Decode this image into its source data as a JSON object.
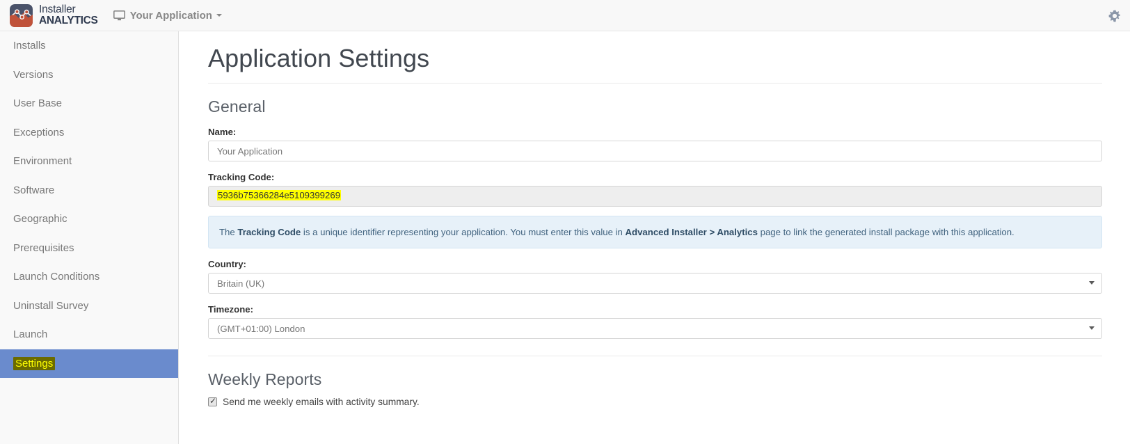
{
  "topbar": {
    "brand_line1": "Installer",
    "brand_line2": "ANALYTICS",
    "app_switcher_label": "Your Application",
    "settings_icon": "gear-icon",
    "monitor_icon": "monitor-icon",
    "logo_top_color": "#4a5269",
    "logo_bottom_color": "#c0523a"
  },
  "sidebar": {
    "items": [
      {
        "label": "Installs",
        "active": false
      },
      {
        "label": "Versions",
        "active": false
      },
      {
        "label": "User Base",
        "active": false
      },
      {
        "label": "Exceptions",
        "active": false
      },
      {
        "label": "Environment",
        "active": false
      },
      {
        "label": "Software",
        "active": false
      },
      {
        "label": "Geographic",
        "active": false
      },
      {
        "label": "Prerequisites",
        "active": false
      },
      {
        "label": "Launch Conditions",
        "active": false
      },
      {
        "label": "Uninstall Survey",
        "active": false
      },
      {
        "label": "Launch",
        "active": false
      },
      {
        "label": "Settings",
        "active": true
      }
    ],
    "active_bg": "#6a8bcd",
    "highlight_bg": "#6b6b00",
    "highlight_fg": "#ffff00"
  },
  "main": {
    "page_title": "Application Settings",
    "general": {
      "section_title": "General",
      "name_label": "Name:",
      "name_value": "Your Application",
      "tracking_label": "Tracking Code:",
      "tracking_value": "5936b75366284e5109399269",
      "tracking_highlight_color": "#ffff00",
      "alert": {
        "part1": "The ",
        "bold1": "Tracking Code",
        "part2": " is a unique identifier representing your application. You must enter this value in ",
        "bold2": "Advanced Installer > Analytics",
        "part3": " page to link the generated install package with this application."
      },
      "country_label": "Country:",
      "country_value": "Britain (UK)",
      "timezone_label": "Timezone:",
      "timezone_value": "(GMT+01:00) London"
    },
    "weekly_reports": {
      "section_title": "Weekly Reports",
      "checkbox_checked": true,
      "checkbox_label": "Send me weekly emails with activity summary."
    }
  }
}
